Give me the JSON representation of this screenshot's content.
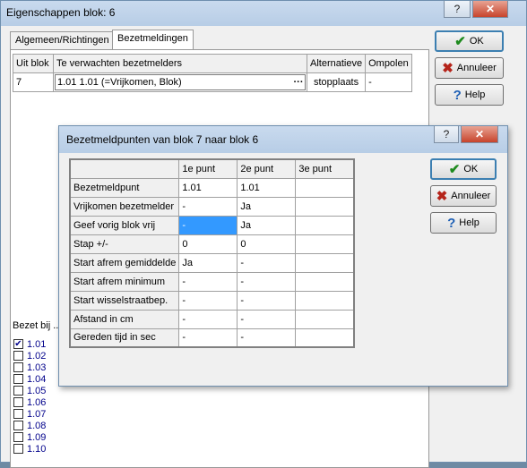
{
  "outer": {
    "title": "Eigenschappen blok: 6",
    "help_symbol": "?",
    "close_symbol": "✕",
    "tabs": [
      {
        "label": "Algemeen/Richtingen"
      },
      {
        "label": "Bezetmeldingen"
      }
    ],
    "table": {
      "headers": [
        "Uit blok",
        "Te verwachten bezetmelders",
        "Alternatieve",
        "Ompolen"
      ],
      "row": {
        "uit_blok": "7",
        "melders": "1.01  1.01 (=Vrijkomen, Blok)",
        "ellipsis": "···",
        "alternatief": "stopplaats",
        "ompolen": "-"
      }
    },
    "bezet_label": "Bezet bij ...",
    "checklist": [
      {
        "label": "1.01",
        "checked": true,
        "mark": "✔"
      },
      {
        "label": "1.02",
        "checked": false,
        "mark": ""
      },
      {
        "label": "1.03",
        "checked": false,
        "mark": ""
      },
      {
        "label": "1.04",
        "checked": false,
        "mark": ""
      },
      {
        "label": "1.05",
        "checked": false,
        "mark": ""
      },
      {
        "label": "1.06",
        "checked": false,
        "mark": ""
      },
      {
        "label": "1.07",
        "checked": false,
        "mark": ""
      },
      {
        "label": "1.08",
        "checked": false,
        "mark": ""
      },
      {
        "label": "1.09",
        "checked": false,
        "mark": ""
      },
      {
        "label": "1.10",
        "checked": false,
        "mark": ""
      }
    ],
    "buttons": {
      "ok": "OK",
      "cancel": "Annuleer",
      "help": "Help",
      "ok_icon": "✔",
      "cancel_icon": "✖",
      "help_icon": "?"
    }
  },
  "dialog": {
    "title": "Bezetmeldpunten van blok 7 naar blok 6",
    "help_symbol": "?",
    "close_symbol": "✕",
    "columns": [
      "1e punt",
      "2e punt",
      "3e punt"
    ],
    "rows": [
      {
        "label": "Bezetmeldpunt",
        "values": [
          "1.01",
          "1.01",
          ""
        ]
      },
      {
        "label": "Vrijkomen bezetmelder",
        "values": [
          "-",
          "Ja",
          ""
        ]
      },
      {
        "label": "Geef vorig blok vrij",
        "values": [
          "-",
          "Ja",
          ""
        ]
      },
      {
        "label": "Stap +/-",
        "values": [
          "0",
          "0",
          ""
        ]
      },
      {
        "label": "Start afrem gemiddelde",
        "values": [
          "Ja",
          "-",
          ""
        ]
      },
      {
        "label": "Start afrem minimum",
        "values": [
          "-",
          "-",
          ""
        ]
      },
      {
        "label": "Start wisselstraatbep.",
        "values": [
          "-",
          "-",
          ""
        ]
      },
      {
        "label": "Afstand in cm",
        "values": [
          "-",
          "-",
          ""
        ]
      },
      {
        "label": "Gereden tijd in sec",
        "values": [
          "-",
          "-",
          ""
        ]
      }
    ],
    "selection_color": "#3399ff",
    "buttons": {
      "ok": "OK",
      "cancel": "Annuleer",
      "help": "Help",
      "ok_icon": "✔",
      "cancel_icon": "✖",
      "help_icon": "?"
    }
  }
}
